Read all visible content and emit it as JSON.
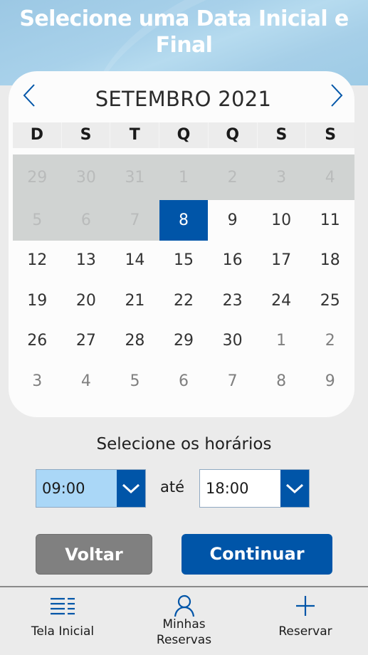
{
  "header": {
    "title_line1": "Selecione uma Data Inicial e",
    "title_line2": "Final"
  },
  "calendar": {
    "month_label": "SETEMBRO 2021",
    "prev_icon": "chevron-left-icon",
    "next_icon": "chevron-right-icon",
    "weekdays": [
      "D",
      "S",
      "T",
      "Q",
      "Q",
      "S",
      "S"
    ],
    "weeks": [
      [
        {
          "d": "29",
          "s": "disabled"
        },
        {
          "d": "30",
          "s": "disabled"
        },
        {
          "d": "31",
          "s": "disabled"
        },
        {
          "d": "1",
          "s": "disabled"
        },
        {
          "d": "2",
          "s": "disabled"
        },
        {
          "d": "3",
          "s": "disabled"
        },
        {
          "d": "4",
          "s": "disabled"
        }
      ],
      [
        {
          "d": "5",
          "s": "disabled"
        },
        {
          "d": "6",
          "s": "disabled"
        },
        {
          "d": "7",
          "s": "disabled"
        },
        {
          "d": "8",
          "s": "selected"
        },
        {
          "d": "9",
          "s": "normal"
        },
        {
          "d": "10",
          "s": "normal"
        },
        {
          "d": "11",
          "s": "normal"
        }
      ],
      [
        {
          "d": "12",
          "s": "normal"
        },
        {
          "d": "13",
          "s": "normal"
        },
        {
          "d": "14",
          "s": "normal"
        },
        {
          "d": "15",
          "s": "normal"
        },
        {
          "d": "16",
          "s": "normal"
        },
        {
          "d": "17",
          "s": "normal"
        },
        {
          "d": "18",
          "s": "normal"
        }
      ],
      [
        {
          "d": "19",
          "s": "normal"
        },
        {
          "d": "20",
          "s": "normal"
        },
        {
          "d": "21",
          "s": "normal"
        },
        {
          "d": "22",
          "s": "normal"
        },
        {
          "d": "23",
          "s": "normal"
        },
        {
          "d": "24",
          "s": "normal"
        },
        {
          "d": "25",
          "s": "normal"
        }
      ],
      [
        {
          "d": "26",
          "s": "normal"
        },
        {
          "d": "27",
          "s": "normal"
        },
        {
          "d": "28",
          "s": "normal"
        },
        {
          "d": "29",
          "s": "normal"
        },
        {
          "d": "30",
          "s": "normal"
        },
        {
          "d": "1",
          "s": "other"
        },
        {
          "d": "2",
          "s": "other"
        }
      ],
      [
        {
          "d": "3",
          "s": "other"
        },
        {
          "d": "4",
          "s": "other"
        },
        {
          "d": "5",
          "s": "other"
        },
        {
          "d": "6",
          "s": "other"
        },
        {
          "d": "7",
          "s": "other"
        },
        {
          "d": "8",
          "s": "other"
        },
        {
          "d": "9",
          "s": "other"
        }
      ]
    ],
    "selected_day": "8"
  },
  "time": {
    "label": "Selecione os horários",
    "start_value": "09:00",
    "separator": "até",
    "end_value": "18:00"
  },
  "actions": {
    "back_label": "Voltar",
    "continue_label": "Continuar"
  },
  "bottom_nav": {
    "items": [
      {
        "label": "Tela Inicial",
        "icon": "list-icon"
      },
      {
        "label": "Minhas Reservas",
        "label_line1": "Minhas",
        "label_line2": "Reservas",
        "icon": "person-icon"
      },
      {
        "label": "Reservar",
        "icon": "plus-icon"
      }
    ]
  },
  "colors": {
    "primary": "#0055a8",
    "disabled_bg": "#d0d3d2",
    "back_button": "#808080",
    "start_time_bg": "#aad7f7"
  }
}
